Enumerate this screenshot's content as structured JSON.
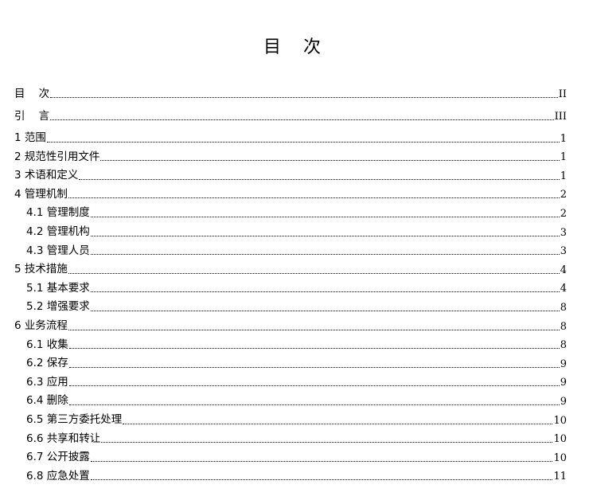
{
  "title": "目    次",
  "front_matter": [
    {
      "label": "目    次",
      "page": "II"
    },
    {
      "label": "引    言",
      "page": "III"
    }
  ],
  "entries": [
    {
      "label": "1 范围",
      "page": "1",
      "level": 1
    },
    {
      "label": "2 规范性引用文件",
      "page": "1",
      "level": 1
    },
    {
      "label": "3 术语和定义",
      "page": "1",
      "level": 1
    },
    {
      "label": "4 管理机制",
      "page": "2",
      "level": 1
    },
    {
      "label": "4.1 管理制度",
      "page": "2",
      "level": 2
    },
    {
      "label": "4.2 管理机构",
      "page": "3",
      "level": 2
    },
    {
      "label": "4.3 管理人员",
      "page": "3",
      "level": 2
    },
    {
      "label": "5 技术措施",
      "page": "4",
      "level": 1
    },
    {
      "label": "5.1 基本要求",
      "page": "4",
      "level": 2
    },
    {
      "label": "5.2 增强要求",
      "page": "8",
      "level": 2
    },
    {
      "label": "6 业务流程",
      "page": "8",
      "level": 1
    },
    {
      "label": "6.1 收集",
      "page": "8",
      "level": 2
    },
    {
      "label": "6.2 保存",
      "page": "9",
      "level": 2
    },
    {
      "label": "6.3 应用",
      "page": "9",
      "level": 2
    },
    {
      "label": "6.4 删除",
      "page": "9",
      "level": 2
    },
    {
      "label": "6.5 第三方委托处理",
      "page": "10",
      "level": 2
    },
    {
      "label": "6.6 共享和转让",
      "page": "10",
      "level": 2
    },
    {
      "label": "6.7 公开披露",
      "page": "10",
      "level": 2
    },
    {
      "label": "6.8 应急处置",
      "page": "11",
      "level": 2
    }
  ]
}
